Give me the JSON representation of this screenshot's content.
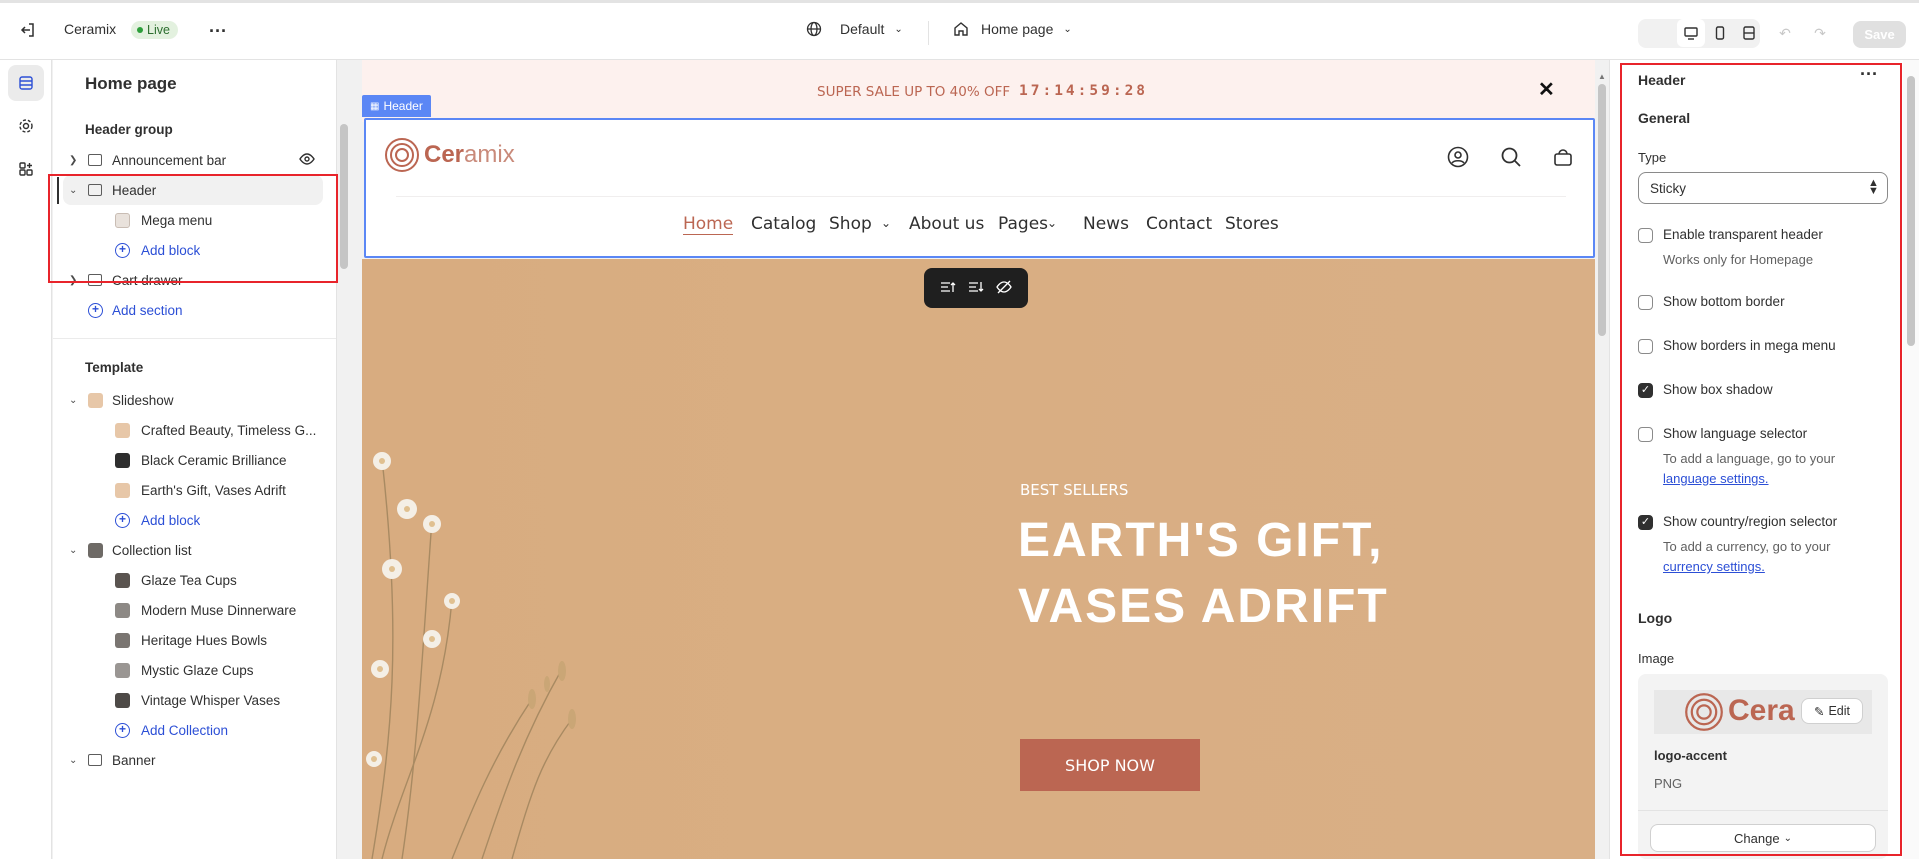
{
  "topbar": {
    "store_name": "Ceramix",
    "status": "Live",
    "theme_selector": "Default",
    "page_selector": "Home page",
    "save_label": "Save"
  },
  "left_panel": {
    "title": "Home page",
    "header_group": {
      "heading": "Header group",
      "items": [
        {
          "label": "Announcement bar"
        },
        {
          "label": "Header",
          "children": [
            {
              "label": "Mega menu"
            }
          ],
          "add_label": "Add block"
        },
        {
          "label": "Cart drawer"
        }
      ],
      "add_section_label": "Add section"
    },
    "template": {
      "heading": "Template",
      "slideshow": {
        "label": "Slideshow",
        "children": [
          "Crafted Beauty, Timeless G...",
          "Black Ceramic Brilliance",
          "Earth's Gift, Vases Adrift"
        ],
        "add_label": "Add block"
      },
      "collection_list": {
        "label": "Collection list",
        "children": [
          "Glaze Tea Cups",
          "Modern Muse Dinnerware",
          "Heritage Hues Bowls",
          "Mystic Glaze Cups",
          "Vintage Whisper Vases"
        ],
        "add_label": "Add Collection"
      },
      "banner": {
        "label": "Banner"
      }
    }
  },
  "preview": {
    "announcement": {
      "text": "SUPER SALE UP TO 40% OFF",
      "countdown": "17:14:59:28"
    },
    "header_tag": "Header",
    "logo": {
      "part1": "Cer",
      "part2": "amix"
    },
    "nav": [
      "Home",
      "Catalog",
      "Shop",
      "About us",
      "Pages",
      "News",
      "Contact",
      "Stores"
    ],
    "hero": {
      "kicker": "BEST SELLERS",
      "title_line1": "EARTH'S GIFT,",
      "title_line2": "VASES ADRIFT",
      "cta": "SHOP NOW"
    }
  },
  "right_panel": {
    "title": "Header",
    "general_heading": "General",
    "type_label": "Type",
    "type_value": "Sticky",
    "options": {
      "transparent": {
        "label": "Enable transparent header",
        "hint": "Works only for Homepage",
        "checked": false
      },
      "bottom_border": {
        "label": "Show bottom border",
        "checked": false
      },
      "mega_borders": {
        "label": "Show borders in mega menu",
        "checked": false
      },
      "box_shadow": {
        "label": "Show box shadow",
        "checked": true
      },
      "language": {
        "label": "Show language selector",
        "hint": "To add a language, go to your",
        "link": "language settings.",
        "checked": false
      },
      "country": {
        "label": "Show country/region selector",
        "hint": "To add a currency, go to your",
        "link": "currency settings.",
        "checked": true
      }
    },
    "logo_heading": "Logo",
    "image_label": "Image",
    "image_preview_text": "Cera",
    "edit_label": "Edit",
    "file_name": "logo-accent",
    "file_type": "PNG",
    "change_label": "Change"
  },
  "colors": {
    "accent": "#2c4fd6",
    "brand": "#bb6652",
    "highlight": "#e8242b",
    "selection": "#5b87f5"
  }
}
